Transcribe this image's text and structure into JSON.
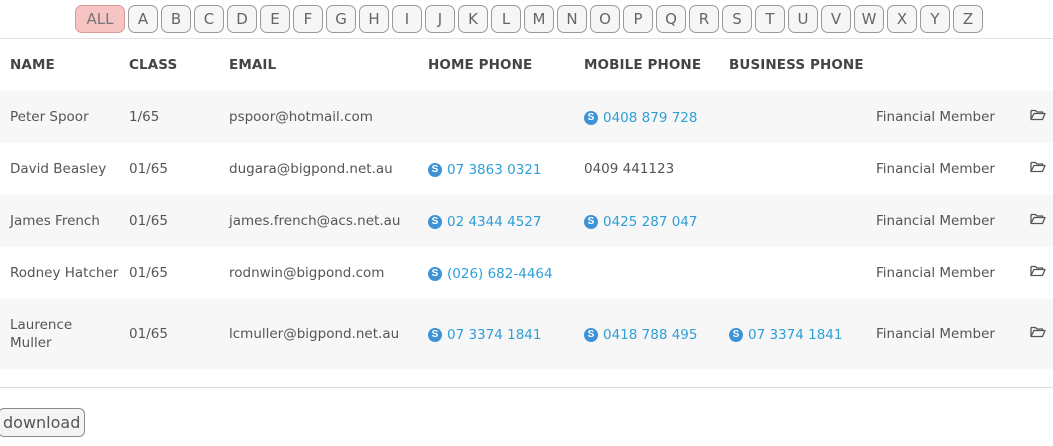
{
  "alphabet": {
    "all_label": "ALL",
    "letters": [
      "A",
      "B",
      "C",
      "D",
      "E",
      "F",
      "G",
      "H",
      "I",
      "J",
      "K",
      "L",
      "M",
      "N",
      "O",
      "P",
      "Q",
      "R",
      "S",
      "T",
      "U",
      "V",
      "W",
      "X",
      "Y",
      "Z"
    ]
  },
  "table": {
    "headers": {
      "name": "NAME",
      "class": "CLASS",
      "email": "EMAIL",
      "home_phone": "HOME PHONE",
      "mobile_phone": "MOBILE PHONE",
      "business_phone": "BUSINESS PHONE"
    },
    "rows": [
      {
        "name": "Peter Spoor",
        "class": "1/65",
        "email": "pspoor@hotmail.com",
        "home_phone": "",
        "home_skype": false,
        "mobile_phone": "0408 879 728",
        "mobile_skype": true,
        "business_phone": "",
        "business_skype": false,
        "status": "Financial Member"
      },
      {
        "name": "David Beasley",
        "class": "01/65",
        "email": "dugara@bigpond.net.au",
        "home_phone": "07 3863 0321",
        "home_skype": true,
        "mobile_phone": "0409 441123",
        "mobile_skype": false,
        "business_phone": "",
        "business_skype": false,
        "status": "Financial Member"
      },
      {
        "name": "James French",
        "class": "01/65",
        "email": "james.french@acs.net.au",
        "home_phone": "02 4344 4527",
        "home_skype": true,
        "mobile_phone": "0425 287 047",
        "mobile_skype": true,
        "business_phone": "",
        "business_skype": false,
        "status": "Financial Member"
      },
      {
        "name": "Rodney Hatcher",
        "class": "01/65",
        "email": "rodnwin@bigpond.com",
        "home_phone": "(026) 682-4464",
        "home_skype": true,
        "mobile_phone": "",
        "mobile_skype": false,
        "business_phone": "",
        "business_skype": false,
        "status": "Financial Member"
      },
      {
        "name": "Laurence Muller",
        "class": "01/65",
        "email": "lcmuller@bigpond.net.au",
        "home_phone": "07 3374 1841",
        "home_skype": true,
        "mobile_phone": "0418 788 495",
        "mobile_skype": true,
        "business_phone": "07 3374 1841",
        "business_skype": true,
        "status": "Financial Member"
      }
    ]
  },
  "skype_glyph": "S",
  "icons": {
    "phone": "skype-icon",
    "open": "folder-open-icon"
  },
  "colors": {
    "link": "#2e9fd8",
    "active_filter": "#f7c4c4",
    "skype": "#3d93d6"
  },
  "download_label": "download"
}
